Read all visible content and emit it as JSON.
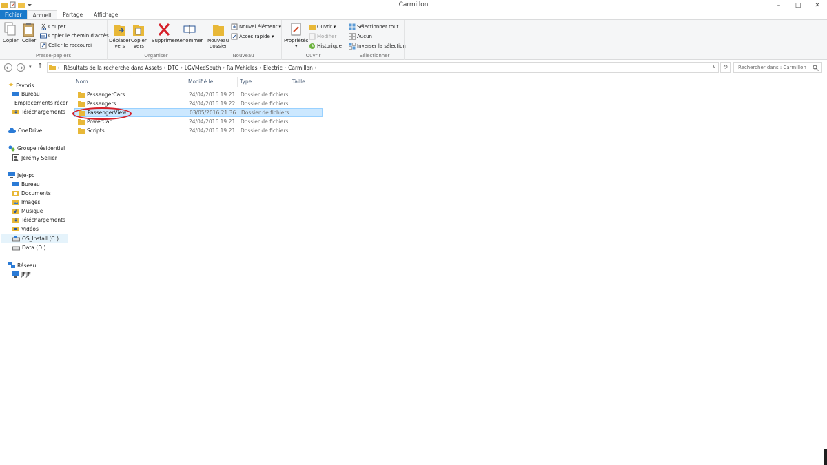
{
  "window": {
    "title": "Carmillon",
    "controls": {
      "minimize": "–",
      "maximize": "□",
      "close": "✕"
    }
  },
  "tabs": [
    {
      "label": "Fichier"
    },
    {
      "label": "Accueil"
    },
    {
      "label": "Partage"
    },
    {
      "label": "Affichage"
    }
  ],
  "ribbon": {
    "clipboard": {
      "label": "Presse-papiers",
      "copy": "Copier",
      "paste": "Coller",
      "cut": "Couper",
      "copy_path": "Copier le chemin d'accès",
      "paste_shortcut": "Coller le raccourci"
    },
    "organize": {
      "label": "Organiser",
      "move_to_1": "Déplacer",
      "move_to_2": "vers",
      "copy_to_1": "Copier",
      "copy_to_2": "vers",
      "delete": "Supprimer",
      "rename": "Renommer"
    },
    "new": {
      "label": "Nouveau",
      "new_folder_1": "Nouveau",
      "new_folder_2": "dossier",
      "new_item": "Nouvel élément",
      "easy_access": "Accès rapide"
    },
    "open": {
      "label": "Ouvrir",
      "properties": "Propriétés",
      "open": "Ouvrir",
      "edit": "Modifier",
      "history": "Historique"
    },
    "select": {
      "label": "Sélectionner",
      "select_all": "Sélectionner tout",
      "select_none": "Aucun",
      "invert": "Inverser la sélection"
    }
  },
  "address": {
    "crumbs": [
      "Résultats de la recherche dans Assets",
      "DTG",
      "LGVMedSouth",
      "RailVehicles",
      "Electric",
      "Carmillon"
    ],
    "search_placeholder": "Rechercher dans : Carmillon"
  },
  "nav": {
    "favorites": "Favoris",
    "desktop": "Bureau",
    "recent": "Emplacements récents",
    "downloads": "Téléchargements",
    "onedrive": "OneDrive",
    "homegroup": "Groupe résidentiel",
    "user": "Jérémy Sellier",
    "pc": "Jeje-pc",
    "pc_desktop": "Bureau",
    "documents": "Documents",
    "images": "Images",
    "music": "Musique",
    "pc_downloads": "Téléchargements",
    "videos": "Vidéos",
    "drive_c": "OS_Install (C:)",
    "drive_d": "Data (D:)",
    "network": "Réseau",
    "network_pc": "JEJE"
  },
  "columns": {
    "name": "Nom",
    "modified": "Modifié le",
    "type": "Type",
    "size": "Taille"
  },
  "files": [
    {
      "name": "PassengerCars",
      "modified": "24/04/2016 19:21",
      "type": "Dossier de fichiers"
    },
    {
      "name": "Passengers",
      "modified": "24/04/2016 19:22",
      "type": "Dossier de fichiers"
    },
    {
      "name": "PassengerView",
      "modified": "03/05/2016 21:36",
      "type": "Dossier de fichiers"
    },
    {
      "name": "PowerCar",
      "modified": "24/04/2016 19:21",
      "type": "Dossier de fichiers"
    },
    {
      "name": "Scripts",
      "modified": "24/04/2016 19:21",
      "type": "Dossier de fichiers"
    }
  ],
  "colors": {
    "accent": "#1979ca",
    "selection": "#cce8ff",
    "annotation": "#d6202a",
    "folder": "#e8b838"
  }
}
